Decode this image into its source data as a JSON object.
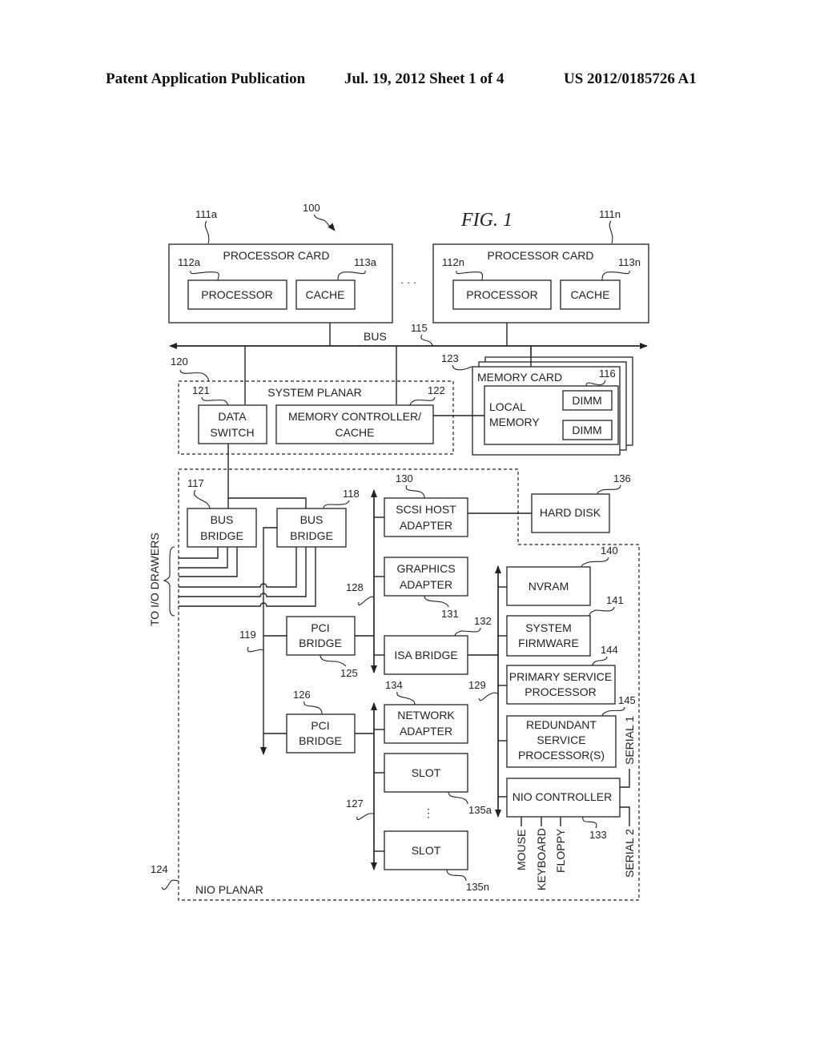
{
  "header": {
    "publication": "Patent Application Publication",
    "date_sheet": "Jul. 19, 2012   Sheet 1 of 4",
    "number": "US 2012/0185726 A1"
  },
  "figure": {
    "title": "FIG. 1",
    "system_ref": "100",
    "processor_cards": [
      {
        "ref": "111a",
        "label": "PROCESSOR CARD",
        "processor": {
          "ref": "112a",
          "label": "PROCESSOR"
        },
        "cache": {
          "ref": "113a",
          "label": "CACHE"
        }
      },
      {
        "ref": "111n",
        "label": "PROCESSOR CARD",
        "processor": {
          "ref": "112n",
          "label": "PROCESSOR"
        },
        "cache": {
          "ref": "113n",
          "label": "CACHE"
        }
      }
    ],
    "ellipsis": "· · ·",
    "bus": {
      "ref": "115",
      "label": "BUS"
    },
    "system_planar": {
      "ref": "120",
      "label": "SYSTEM PLANAR",
      "data_switch": {
        "ref": "121",
        "line1": "DATA",
        "line2": "SWITCH"
      },
      "memory_controller": {
        "ref": "122",
        "line1": "MEMORY CONTROLLER/",
        "line2": "CACHE"
      }
    },
    "memory_card": {
      "ref": "123",
      "label": "MEMORY CARD",
      "local_memory": {
        "ref": "116",
        "line1": "LOCAL",
        "line2": "MEMORY"
      },
      "dimms": [
        "DIMM",
        "DIMM"
      ]
    },
    "nio_planar": {
      "ref": "124",
      "label": "NIO PLANAR"
    },
    "bus_bridges": [
      {
        "ref": "117",
        "line1": "BUS",
        "line2": "BRIDGE"
      },
      {
        "ref": "118",
        "line1": "BUS",
        "line2": "BRIDGE"
      }
    ],
    "io_drawers_label": "TO I/O DRAWERS",
    "pci_bus_ref": "119",
    "pci_bridges": [
      {
        "ref": "125",
        "line1": "PCI",
        "line2": "BRIDGE"
      },
      {
        "ref": "126",
        "line1": "PCI",
        "line2": "BRIDGE"
      }
    ],
    "pci_bus_refs": {
      "upper": "128",
      "lower": "127",
      "isa": "129"
    },
    "scsi": {
      "ref": "130",
      "line1": "SCSI HOST",
      "line2": "ADAPTER"
    },
    "hard_disk": {
      "ref": "136",
      "label": "HARD DISK"
    },
    "graphics": {
      "ref": "131",
      "line1": "GRAPHICS",
      "line2": "ADAPTER"
    },
    "isa_bridge": {
      "ref": "132",
      "label": "ISA BRIDGE"
    },
    "network": {
      "ref": "134",
      "line1": "NETWORK",
      "line2": "ADAPTER"
    },
    "slots": [
      {
        "ref": "135a",
        "label": "SLOT"
      },
      {
        "ref": "135n",
        "label": "SLOT"
      }
    ],
    "vertical_ellipsis": "⋮",
    "nvram": {
      "ref": "140",
      "label": "NVRAM"
    },
    "firmware": {
      "ref": "141",
      "line1": "SYSTEM",
      "line2": "FIRMWARE"
    },
    "primary_sp": {
      "ref": "144",
      "line1": "PRIMARY SERVICE",
      "line2": "PROCESSOR"
    },
    "redundant_sp": {
      "ref": "145",
      "line1": "REDUNDANT",
      "line2": "SERVICE",
      "line3": "PROCESSOR(S)"
    },
    "nio_controller": {
      "ref": "133",
      "label": "NIO CONTROLLER"
    },
    "nio_ports": [
      "MOUSE",
      "KEYBOARD",
      "FLOPPY"
    ],
    "serial_ports": [
      "SERIAL 1",
      "SERIAL 2"
    ]
  }
}
